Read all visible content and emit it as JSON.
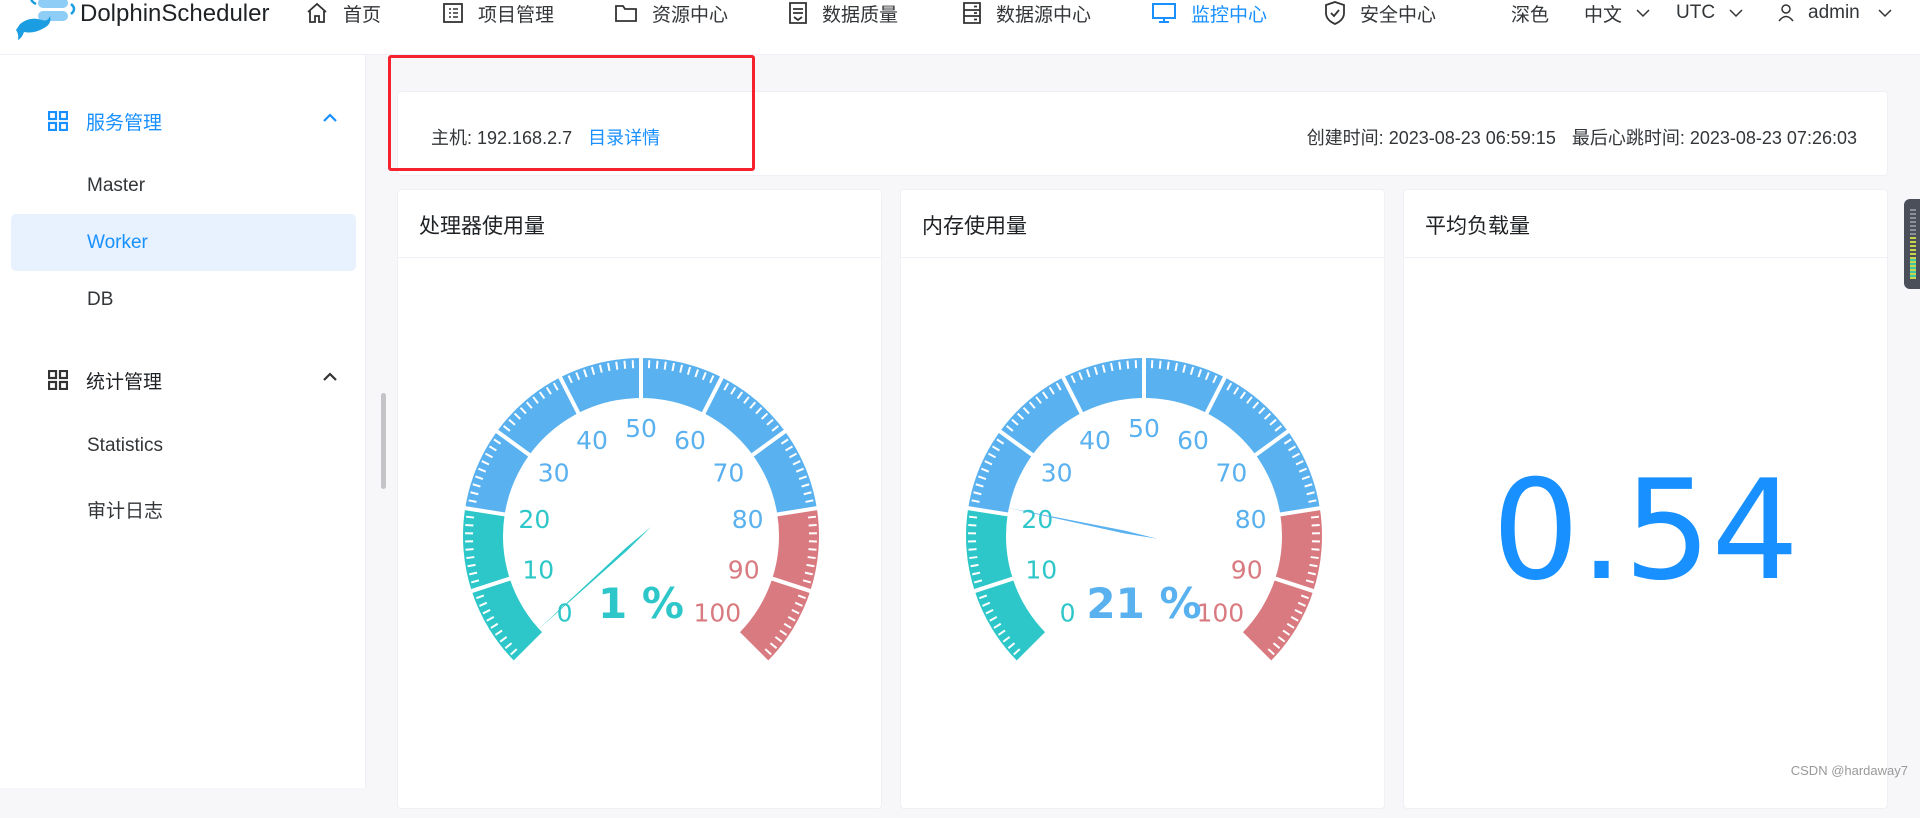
{
  "header": {
    "brand": "DolphinScheduler",
    "nav": [
      {
        "label": "首页",
        "icon": "home-icon"
      },
      {
        "label": "项目管理",
        "icon": "project-icon"
      },
      {
        "label": "资源中心",
        "icon": "folder-icon"
      },
      {
        "label": "数据质量",
        "icon": "data-quality-icon"
      },
      {
        "label": "数据源中心",
        "icon": "datasource-icon"
      },
      {
        "label": "监控中心",
        "icon": "monitor-icon",
        "active": true
      },
      {
        "label": "安全中心",
        "icon": "shield-icon"
      }
    ],
    "theme": "深色",
    "language": "中文",
    "timezone": "UTC",
    "user": "admin"
  },
  "sidebar": {
    "groups": [
      {
        "label": "服务管理",
        "expanded": true,
        "active": true,
        "items": [
          "Master",
          "Worker",
          "DB"
        ]
      },
      {
        "label": "统计管理",
        "expanded": true,
        "active": false,
        "items": [
          "Statistics",
          "审计日志"
        ]
      }
    ],
    "selected": "Worker"
  },
  "info": {
    "host_label": "主机: 192.168.2.7",
    "details_link": "目录详情",
    "created": "创建时间: 2023-08-23 06:59:15",
    "heartbeat": "最后心跳时间: 2023-08-23 07:26:03"
  },
  "cards": {
    "cpu": {
      "title": "处理器使用量",
      "value": 1,
      "display": "1 %"
    },
    "memory": {
      "title": "内存使用量",
      "value": 21,
      "display": "21 %"
    },
    "load": {
      "title": "平均负载量",
      "value": "0.54"
    }
  },
  "gauge": {
    "min": 0,
    "max": 100,
    "ticks": [
      "0",
      "10",
      "20",
      "30",
      "40",
      "50",
      "60",
      "70",
      "80",
      "90",
      "100"
    ],
    "colors": {
      "low": "#2ec7c9",
      "mid": "#5ab1ef",
      "high": "#d87a80"
    },
    "thresholds": [
      0.2,
      0.8
    ]
  },
  "watermark": "CSDN @hardaway7",
  "colors": {
    "accent": "#1890ff",
    "highlight_box": "#f5222d"
  }
}
